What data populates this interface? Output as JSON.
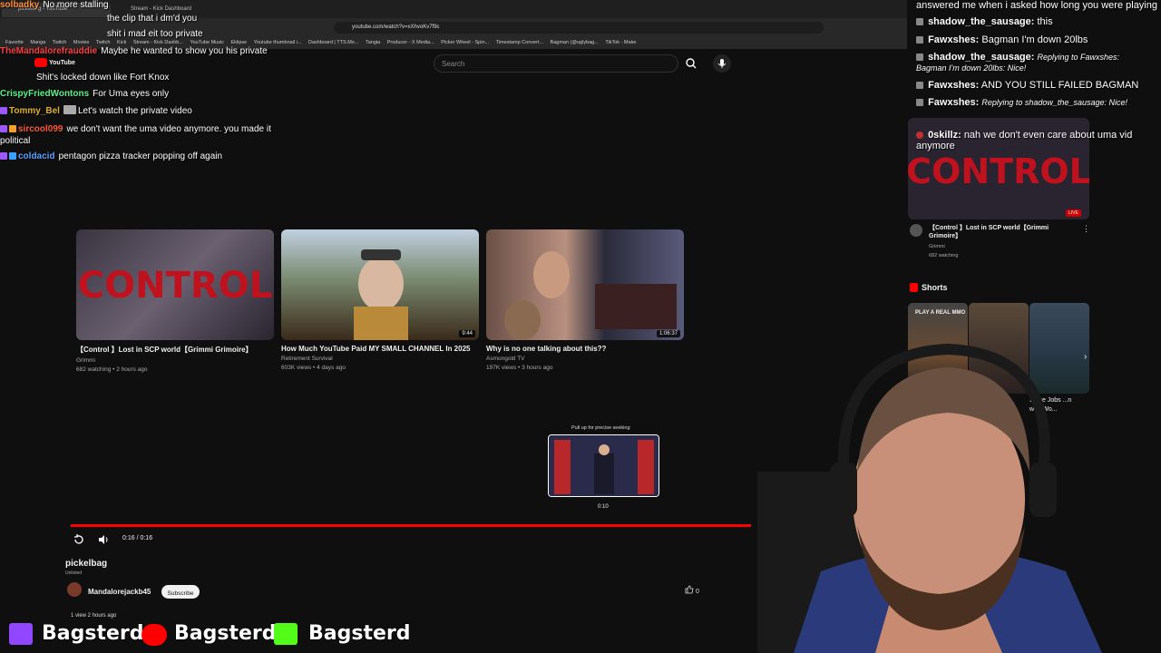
{
  "browser": {
    "tabs": [
      "pickelbag - YouTube",
      "Stream - Kick Dashboard"
    ],
    "url": "youtube.com/watch?v=xXhvoKv7f9c",
    "bookmarks": [
      "Favorite",
      "Manga",
      "Twitch",
      "Movies",
      "Twitch",
      "Kick",
      "Stream - Kick Dashb...",
      "YouTube Music",
      "Eklipse",
      "Youtube thumbnail i...",
      "Dashboard | TTS.Mo...",
      "Tangia",
      "Producer - X Media...",
      "Picker Wheel - Spin...",
      "Timestamp Convert...",
      "Bagman (@uglybag...",
      "TikTok - Make"
    ]
  },
  "header": {
    "logo": "YouTube",
    "search_placeholder": "Search"
  },
  "chat_left": [
    {
      "user": "solbadky",
      "text": "No more stalling",
      "color": "#ff8c3a"
    },
    {
      "user": "",
      "text": "the clip that i dm'd you",
      "color": "#9b59ff"
    },
    {
      "user": "",
      "text": "shit i mad eit too private",
      "color": "#9b59ff"
    },
    {
      "user": "TheMandalorefrauddie",
      "text": "Maybe he wanted to show you his private",
      "color": "#ff4040"
    },
    {
      "user": "",
      "text": "Shit's locked down like Fort Knox",
      "color": "#4a6aff"
    },
    {
      "user": "CrispyFriedWontons",
      "text": "For Uma eyes only",
      "color": "#5ef08a"
    },
    {
      "user": "Tommy_Bel",
      "text": "Let's watch the private video",
      "color": "#e0b030"
    },
    {
      "user": "sircool099",
      "text": "we don't want the uma video anymore. you made it political",
      "color": "#ff5a3a"
    },
    {
      "user": "coldacid",
      "text": "pentagon pizza tracker popping off again",
      "color": "#5aa0ff"
    }
  ],
  "cards": [
    {
      "title": "【Control 】Lost in SCP world【Grimmi Grimoire】",
      "channel": "Grimmi",
      "meta": "682 watching • 2 hours ago",
      "duration": ""
    },
    {
      "title": "How Much YouTube Paid MY SMALL CHANNEL In 2025",
      "channel": "Retirement Survival",
      "meta": "603K views • 4 days ago",
      "duration": "9:44"
    },
    {
      "title": "Why is no one talking about this??",
      "channel": "Asmongold TV",
      "meta": "197K views • 3 hours ago",
      "duration": "1:06:37"
    }
  ],
  "player": {
    "seek_tip": "Pull up for precise seeking",
    "scrub_time": "0:10",
    "time_display": "0:16 / 0:16",
    "progress": 1.0
  },
  "video": {
    "title": "pickelbag",
    "visibility": "Unlisted",
    "channel": "Mandalorejackb45",
    "subscribe_label": "Subscribe",
    "likes": "0",
    "views": "1 view  2 hours ago"
  },
  "sidebar": {
    "live": {
      "title": "【Control 】Lost in SCP world【Grimmi Grimoire】",
      "channel": "Grimmi",
      "watching": "682 watching",
      "badge": "LIVE",
      "thumb_text": "CONTROL"
    },
    "shorts_label": "Shorts",
    "shorts": [
      {
        "caption": "PLAY A REAL MMO"
      },
      {
        "caption": "Steve Jobs ...n why Wo..."
      }
    ]
  },
  "chat_right": [
    {
      "user": "",
      "text": "answered me when i asked how long you were playing"
    },
    {
      "user": "shadow_the_sausage:",
      "text": "this"
    },
    {
      "user": "Fawxshes:",
      "text": "Bagman I'm down 20lbs"
    },
    {
      "user": "shadow_the_sausage:",
      "text": "Replying to Fawxshes: Bagman I'm down 20lbs: Nice!"
    },
    {
      "user": "Fawxshes:",
      "text": "AND YOU STILL FAILED BAGMAN"
    },
    {
      "user": "Fawxshes:",
      "text": "Replying to shadow_the_sausage: Nice!"
    },
    {
      "user": "0skillz:",
      "text": "nah we don't even care about uma vid anymore"
    }
  ],
  "overlay": {
    "names": [
      "Bagsterd",
      "Bagsterd",
      "Bagsterd"
    ]
  },
  "colors": {
    "accent": "#ff0000",
    "bg": "#0f0f0f"
  }
}
